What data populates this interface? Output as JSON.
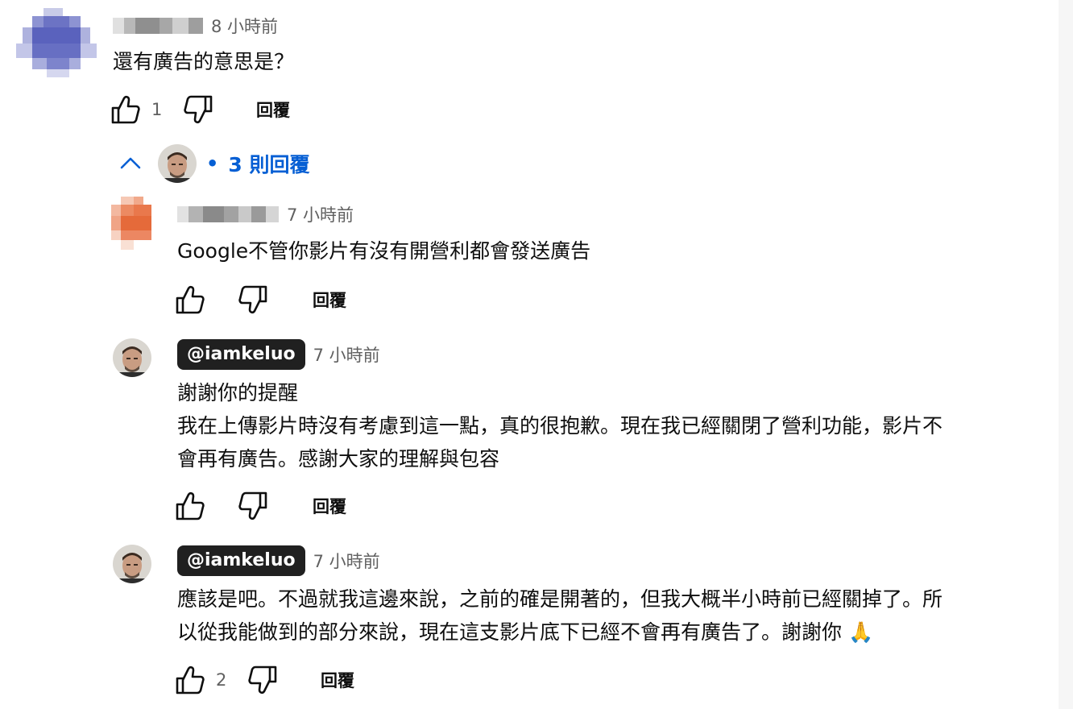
{
  "colors": {
    "accent": "#065fd4",
    "badge_bg": "#202020",
    "meta_text": "#606060"
  },
  "top_comment": {
    "time": "8 小時前",
    "text": "還有廣告的意思是？",
    "like_count": "1",
    "reply_label": "回覆"
  },
  "replies_toggle": {
    "label": "3 則回覆",
    "separator": "•",
    "icon": "chevron-up-icon"
  },
  "replies": [
    {
      "time": "7 小時前",
      "text": "Google不管你影片有沒有開營利都會發送廣告",
      "like_count": "",
      "reply_label": "回覆"
    },
    {
      "handle": "@iamkeluo",
      "time": "7 小時前",
      "text": "謝謝你的提醒\n我在上傳影片時沒有考慮到這一點，真的很抱歉。現在我已經關閉了營利功能，影片不\n會再有廣告。感謝大家的理解與包容",
      "like_count": "",
      "reply_label": "回覆"
    },
    {
      "handle": "@iamkeluo",
      "time": "7 小時前",
      "text": "應該是吧。不過就我這邊來說，之前的確是開著的，但我大概半小時前已經關掉了。所\n以從我能做到的部分來說，現在這支影片底下已經不會再有廣告了。謝謝你 🙏",
      "like_count": "2",
      "reply_label": "回覆"
    }
  ]
}
